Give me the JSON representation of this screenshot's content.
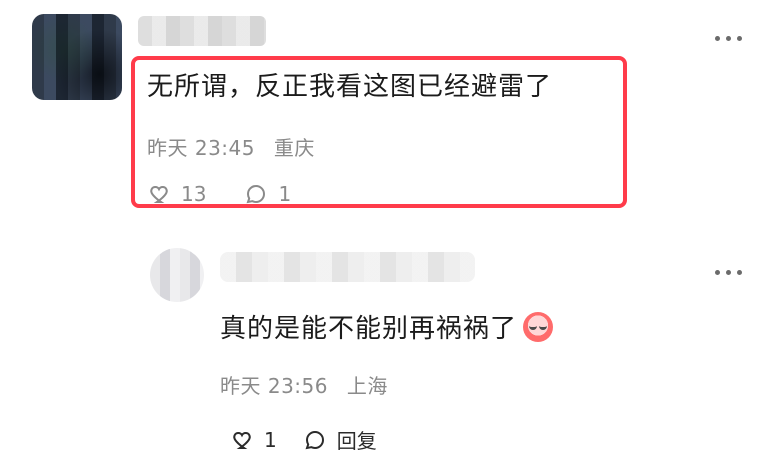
{
  "comment": {
    "text": "无所谓，反正我看这图已经避雷了",
    "time": "昨天 23:45",
    "location": "重庆",
    "like_count": "13",
    "reply_count": "1",
    "highlight_color": "#ff3b4a"
  },
  "reply": {
    "text": "真的是能不能别再祸祸了",
    "emoji": "crying-clown-face",
    "time": "昨天 23:56",
    "location": "上海",
    "like_count": "1",
    "reply_label": "回复"
  },
  "icons": {
    "more": "more-dots-icon",
    "like": "heart-icon",
    "comment": "comment-bubble-icon"
  }
}
